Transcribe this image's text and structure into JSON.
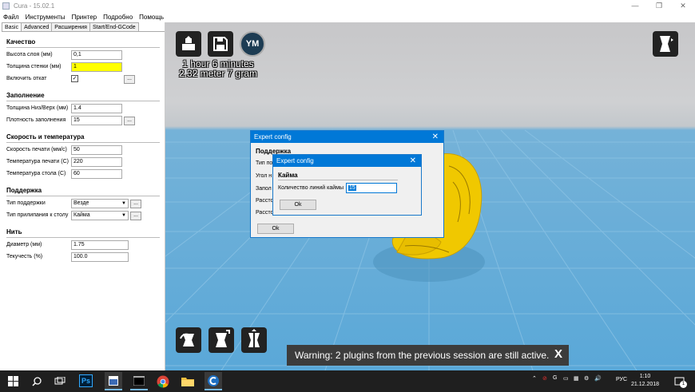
{
  "window": {
    "title": "Cura - 15.02.1"
  },
  "menu": [
    "Файл",
    "Инструменты",
    "Принтер",
    "Подробно",
    "Помощь"
  ],
  "tabs": [
    "Basic",
    "Advanced",
    "Расширения",
    "Start/End-GCode"
  ],
  "sections": {
    "quality": "Качество",
    "fill": "Заполнение",
    "speed": "Скорость и температура",
    "support": "Поддержка",
    "filament": "Нить"
  },
  "fields": {
    "layer_height": {
      "label": "Высота слоя (мм)",
      "value": "0,1"
    },
    "wall_thickness": {
      "label": "Толщина стенки (мм)",
      "value": "1"
    },
    "retraction": {
      "label": "Включить откат",
      "checked": "✓"
    },
    "bottom_top": {
      "label": "Толщина Низ/Верх (мм)",
      "value": "1.4"
    },
    "fill_density": {
      "label": "Плотность заполнения",
      "value": "15"
    },
    "print_speed": {
      "label": "Скорость печати (мм/с)",
      "value": "50"
    },
    "print_temp": {
      "label": "Температура печати (С)",
      "value": "220"
    },
    "bed_temp": {
      "label": "Температура стола (С)",
      "value": "60"
    },
    "support_type": {
      "label": "Тип поддержки",
      "value": "Везде"
    },
    "adhesion": {
      "label": "Тип прилипания к столу",
      "value": "Кайма"
    },
    "diameter": {
      "label": "Диаметр (мм)",
      "value": "1.75"
    },
    "flow": {
      "label": "Текучесть (%)",
      "value": "100.0"
    }
  },
  "dots_label": "...",
  "viewport": {
    "ym_label": "YM",
    "print_time": "1 hour 6 minutes",
    "print_material": "2.32 meter 7 gram",
    "warning": "Warning: 2 plugins from the previous session are still active.",
    "warning_close": "X"
  },
  "expert_dialog": {
    "title": "Expert config",
    "close": "✕",
    "header": "Поддержка",
    "labels": [
      "Тип по",
      "Угол н",
      "Запол",
      "Рассто",
      "Рассто"
    ],
    "ok": "Ok"
  },
  "inner_dialog": {
    "title": "Expert config",
    "close": "✕",
    "header": "Кайма",
    "label": "Количество линий каймы",
    "value": "15",
    "ok": "Ok"
  },
  "taskbar": {
    "lang": "РУС",
    "time": "1:10",
    "date": "21.12.2018",
    "notif_count": "1",
    "icons": [
      "windows-start",
      "search",
      "task-view",
      "photoshop",
      "app",
      "terminal",
      "chrome",
      "file-explorer",
      "cura"
    ]
  },
  "colors": {
    "accent": "#0078d7",
    "model": "#f0c800",
    "highlight_field": "#ffff00",
    "floor": "#5aa8d8"
  }
}
